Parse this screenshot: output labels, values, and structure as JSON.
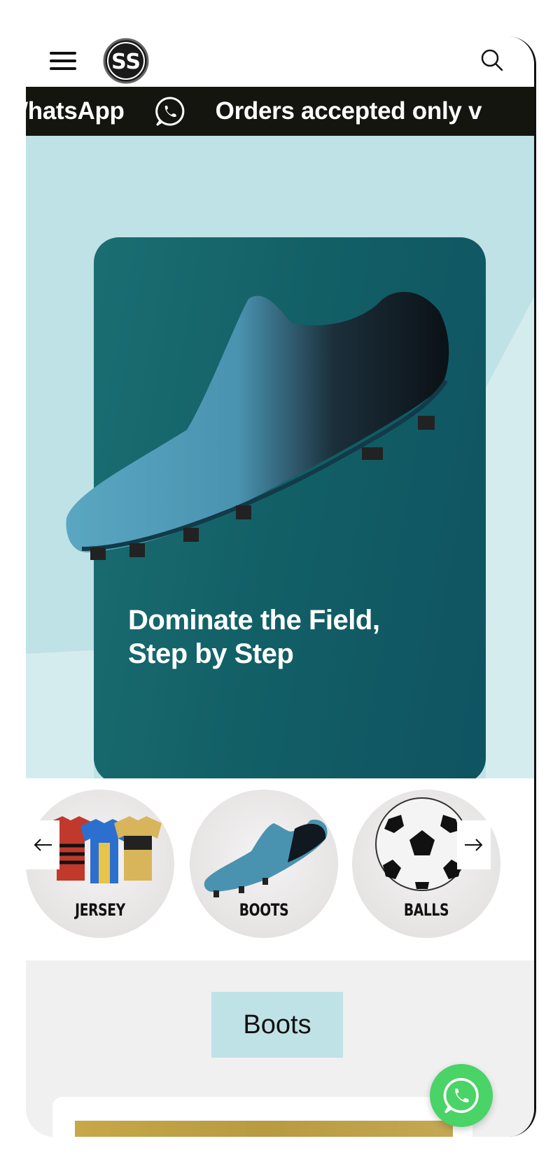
{
  "header": {
    "menu_icon": "hamburger-menu-icon",
    "logo": "SS",
    "search_icon": "search-icon"
  },
  "announcement": {
    "text_before": "WhatsApp",
    "text_after": "Orders accepted only v",
    "icon": "whatsapp-icon"
  },
  "hero": {
    "title_line1": "Dominate the Field,",
    "title_line2": "Step by Step",
    "colors": {
      "background": "#bfe2e6",
      "card": "#125f66"
    }
  },
  "categories": {
    "items": [
      {
        "label": "JERSEY",
        "icon": "jersey-image"
      },
      {
        "label": "BOOTS",
        "icon": "boot-image"
      },
      {
        "label": "BALLS",
        "icon": "ball-image"
      }
    ],
    "prev_icon": "arrow-left-icon",
    "next_icon": "arrow-right-icon"
  },
  "section": {
    "title": "Boots"
  },
  "floating_whatsapp": {
    "icon": "whatsapp-icon",
    "color": "#4ad366"
  }
}
